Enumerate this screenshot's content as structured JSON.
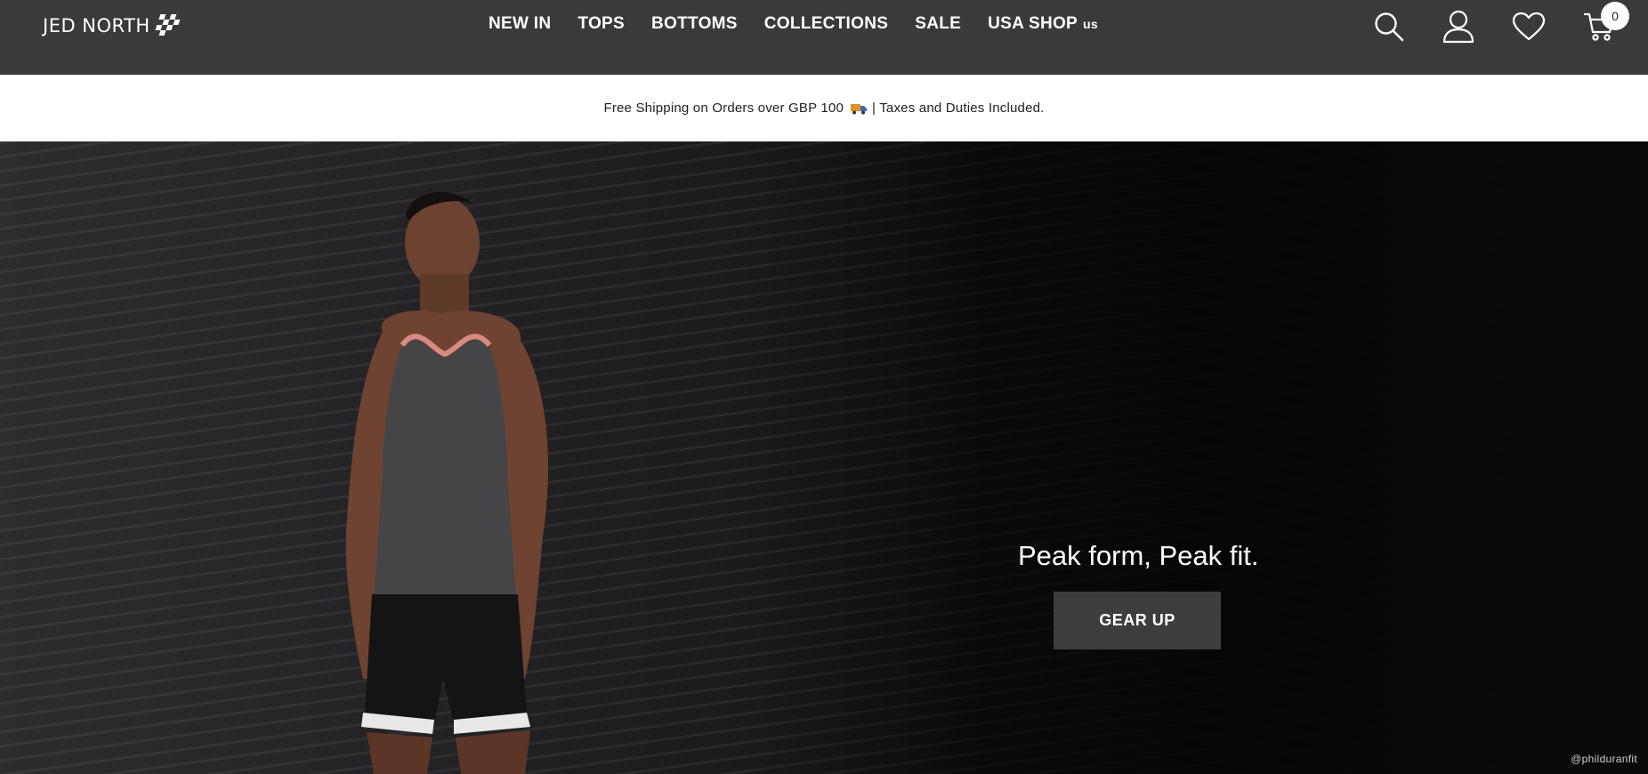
{
  "header": {
    "logo_text": "JED NORTH",
    "nav": [
      {
        "label": "NEW IN"
      },
      {
        "label": "TOPS"
      },
      {
        "label": "BOTTOMS"
      },
      {
        "label": "COLLECTIONS"
      },
      {
        "label": "SALE"
      },
      {
        "label": "USA SHOP",
        "tag": "us"
      }
    ],
    "icons": [
      "search-icon",
      "account-icon",
      "wishlist-heart-icon",
      "cart-icon"
    ],
    "cart_count": "0"
  },
  "announcement": {
    "text_before": "Free Shipping on Orders over GBP 100",
    "text_after": "| Taxes and Duties Included."
  },
  "hero": {
    "heading": "Peak form, Peak fit.",
    "cta_label": "GEAR UP",
    "photo_credit": "@philduranfit"
  },
  "colors": {
    "header_bg": "#3a3a3a",
    "announcement_bg": "#ffffff",
    "cta_bg": "#3d3c3e",
    "hero_bg": "#111113"
  }
}
